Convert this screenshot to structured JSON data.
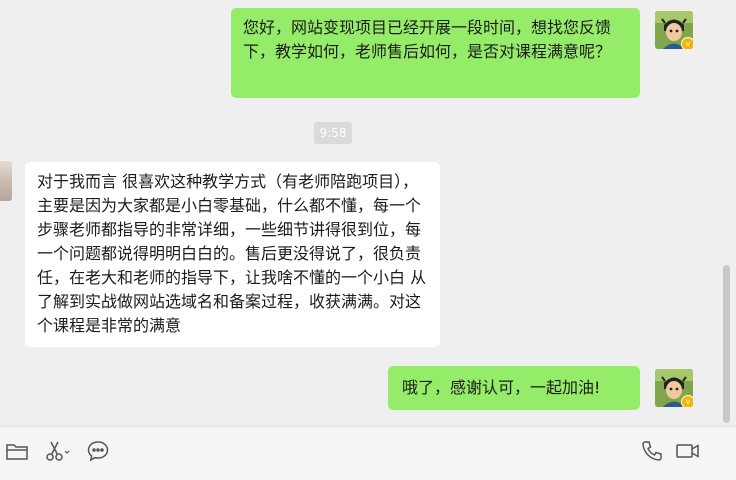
{
  "messages": [
    {
      "sender": "me",
      "text": "您好，网站变现项目已经开展一段时间，想找您反馈下，教学如何，老师售后如何，是否对课程满意呢？"
    },
    {
      "sender": "them",
      "text": "对于我而言 很喜欢这种教学方式（有老师陪跑项目），主要是因为大家都是小白零基础，什么都不懂，每一个步骤老师都指导的非常详细，一些细节讲得很到位，每一个问题都说得明明白白的。售后更没得说了，很负责任，在老大和老师的指导下，让我啥不懂的一个小白 从了解到实战做网站选域名和备案过程，收获满满。对这个课程是非常的满意"
    },
    {
      "sender": "me",
      "text": "哦了，感谢认可，一起加油!"
    }
  ],
  "timestamp": "9:58",
  "badge": "v",
  "colors": {
    "my_bubble": "#95ec69",
    "their_bubble": "#ffffff",
    "background": "#efefef",
    "toolbar": "#f5f5f5"
  },
  "toolbar": {
    "left_icons": [
      "folder-icon",
      "scissors-icon",
      "chat-bubble-icon"
    ],
    "right_icons": [
      "phone-icon",
      "video-call-icon"
    ]
  }
}
